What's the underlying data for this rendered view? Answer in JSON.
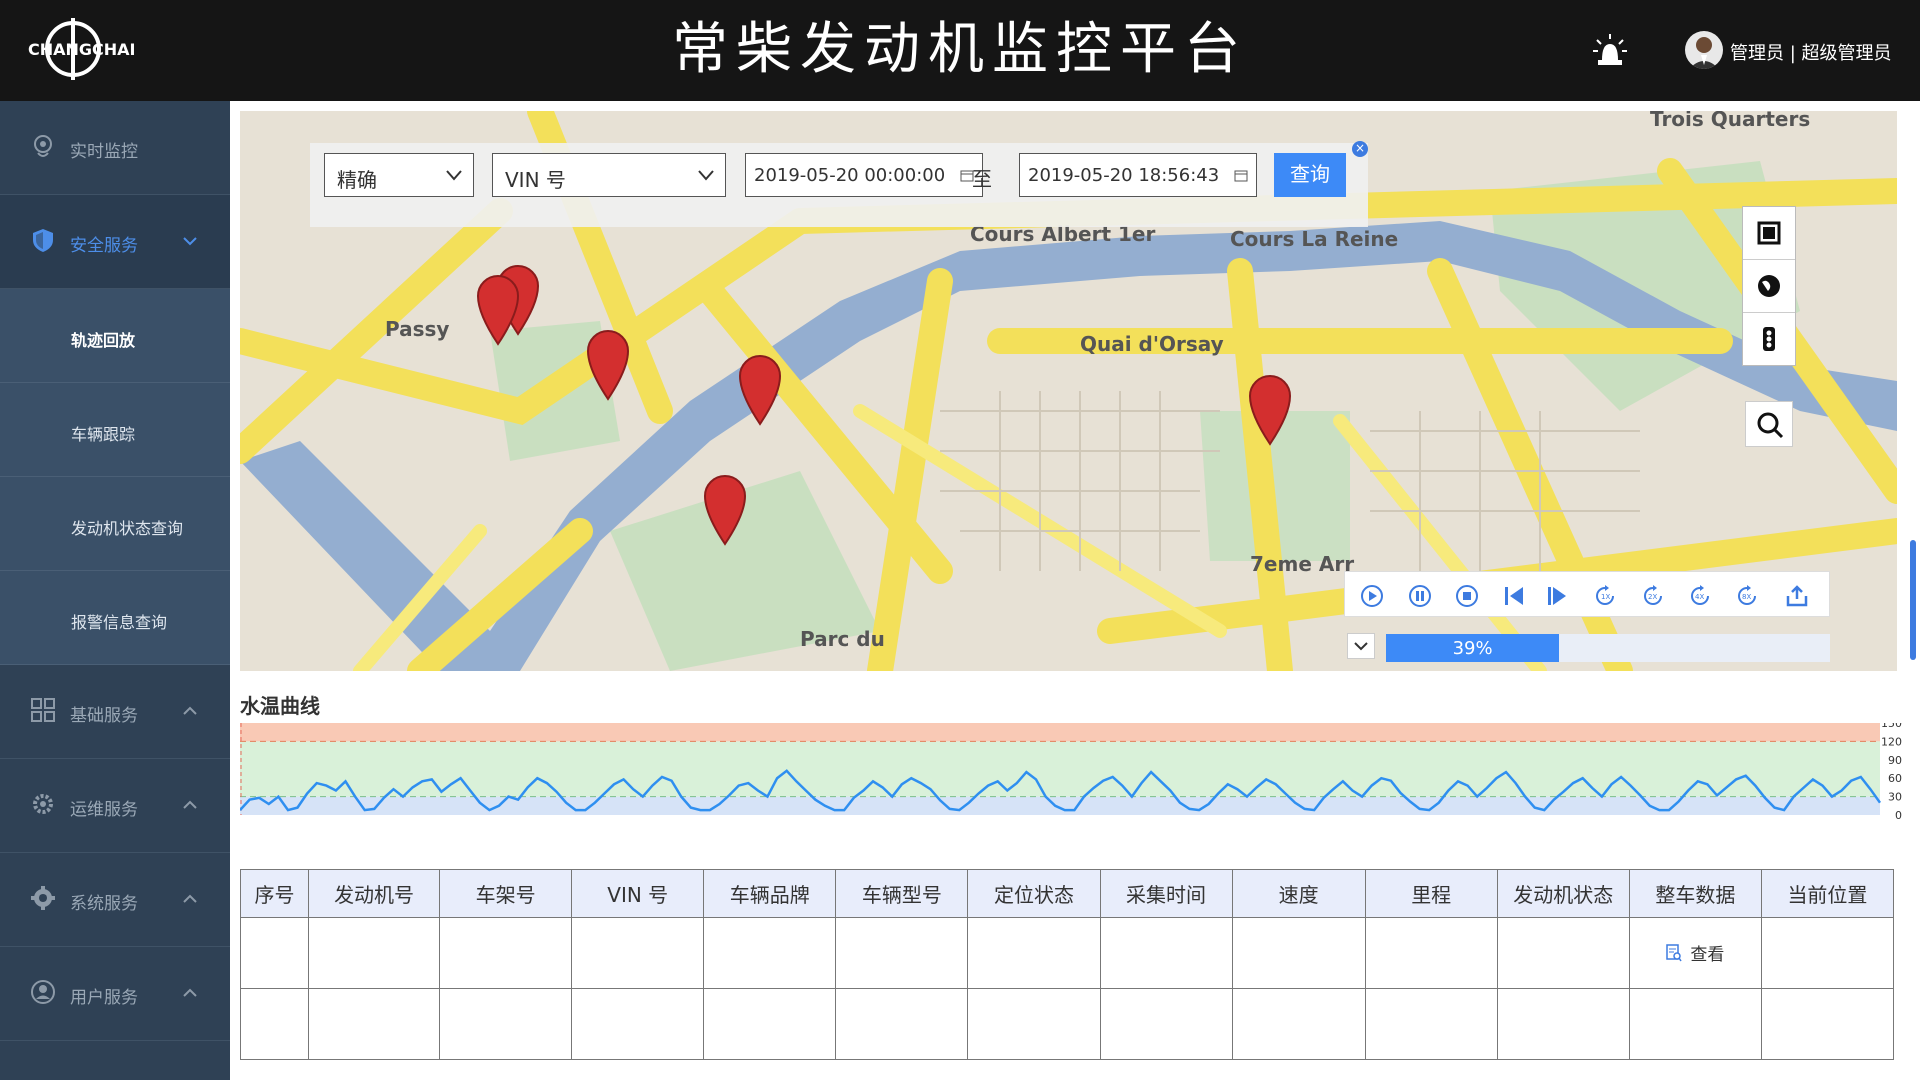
{
  "header": {
    "logo_text": "CHANGCHAI",
    "title": "常柴发动机监控平台",
    "user": "管理员 | 超级管理员",
    "alarm_icon": "alarm-light-icon"
  },
  "sidebar": {
    "items": [
      {
        "label": "实时监控",
        "icon": "location-icon"
      },
      {
        "label": "安全服务",
        "icon": "shield-icon"
      },
      {
        "label": "基础服务",
        "icon": "grid-icon"
      },
      {
        "label": "运维服务",
        "icon": "gear-icon"
      },
      {
        "label": "系统服务",
        "icon": "cog-icon"
      },
      {
        "label": "用户服务",
        "icon": "user-icon"
      }
    ],
    "sub_items": [
      {
        "label": "轨迹回放"
      },
      {
        "label": "车辆跟踪"
      },
      {
        "label": "发动机状态查询"
      },
      {
        "label": "报警信息查询"
      }
    ]
  },
  "search": {
    "mode": "精确",
    "field": "VIN 号",
    "start": "2019-05-20 00:00:00",
    "to_label": "至",
    "end": "2019-05-20 18:56:43",
    "query_label": "查询",
    "close": "×"
  },
  "player": {
    "progress_value": 39,
    "progress_text": "39%"
  },
  "chart": {
    "title": "水温曲线"
  },
  "chart_data": {
    "type": "area",
    "title": "水温曲线",
    "ylim": [
      0,
      150
    ],
    "yticks": [
      0,
      30,
      60,
      90,
      120,
      150
    ],
    "bands": [
      {
        "from": 120,
        "to": 150,
        "color": "#f9c9b5"
      },
      {
        "from": 30,
        "to": 120,
        "color": "#d9f1d9"
      },
      {
        "from": 0,
        "to": 30,
        "color": "#d6e3f7"
      }
    ],
    "threshold_lines": [
      120,
      30
    ],
    "series": [
      {
        "values": [
          8,
          25,
          28,
          18,
          30,
          8,
          12,
          35,
          52,
          48,
          40,
          55,
          30,
          8,
          10,
          28,
          42,
          30,
          45,
          55,
          58,
          38,
          50,
          60,
          40,
          20,
          8,
          15,
          30,
          25,
          45,
          60,
          52,
          38,
          20,
          8,
          8,
          20,
          35,
          50,
          58,
          42,
          30,
          48,
          62,
          56,
          30,
          12,
          8,
          8,
          18,
          32,
          48,
          52,
          40,
          30,
          60,
          72,
          55,
          40,
          25,
          15,
          8,
          8,
          28,
          40,
          55,
          45,
          30,
          50,
          60,
          52,
          42,
          24,
          10,
          8,
          20,
          35,
          48,
          55,
          40,
          52,
          70,
          58,
          30,
          15,
          8,
          8,
          30,
          44,
          56,
          62,
          48,
          30,
          52,
          70,
          55,
          40,
          20,
          10,
          8,
          18,
          35,
          50,
          42,
          30,
          45,
          58,
          50,
          35,
          20,
          10,
          8,
          28,
          42,
          55,
          40,
          30,
          48,
          60,
          56,
          36,
          22,
          10,
          8,
          20,
          40,
          55,
          48,
          30,
          44,
          60,
          70,
          52,
          30,
          12,
          8,
          25,
          38,
          52,
          60,
          44,
          30,
          50,
          62,
          48,
          32,
          15,
          8,
          8,
          22,
          40,
          55,
          50,
          32,
          45,
          58,
          64,
          48,
          28,
          12,
          8,
          30,
          44,
          58,
          48,
          30,
          40,
          56,
          62,
          42,
          20
        ]
      }
    ]
  },
  "table": {
    "headers": [
      "序号",
      "发动机号",
      "车架号",
      "VIN 号",
      "车辆品牌",
      "车辆型号",
      "定位状态",
      "采集时间",
      "速度",
      "里程",
      "发动机状态",
      "整车数据",
      "当前位置"
    ],
    "view_label": "查看"
  },
  "colors": {
    "accent": "#3d8af7",
    "sidebar_bg": "#2f4155",
    "header_bg": "#151515"
  }
}
